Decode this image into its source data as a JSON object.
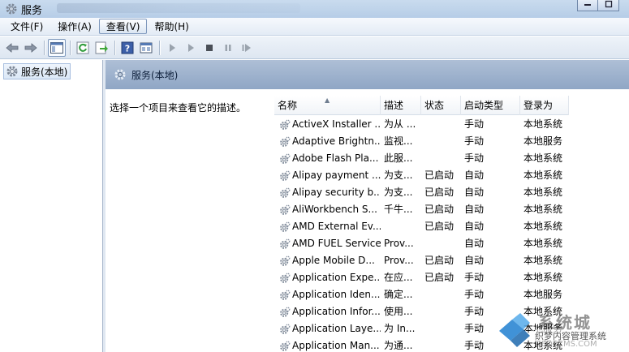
{
  "window": {
    "title": "服务",
    "controls": [
      "minimize",
      "maximize"
    ]
  },
  "menu": [
    {
      "label": "文件(F)"
    },
    {
      "label": "操作(A)"
    },
    {
      "label": "查看(V)"
    },
    {
      "label": "帮助(H)"
    }
  ],
  "tree": {
    "root_label": "服务(本地)"
  },
  "content": {
    "header_title": "服务(本地)",
    "description": "选择一个项目来查看它的描述。"
  },
  "columns": [
    "名称",
    "描述",
    "状态",
    "启动类型",
    "登录为"
  ],
  "services": [
    {
      "name": "ActiveX Installer ...",
      "desc": "为从 ...",
      "status": "",
      "startup": "手动",
      "logon": "本地系统"
    },
    {
      "name": "Adaptive Brightn...",
      "desc": "监视...",
      "status": "",
      "startup": "手动",
      "logon": "本地服务"
    },
    {
      "name": "Adobe Flash Pla...",
      "desc": "此服...",
      "status": "",
      "startup": "手动",
      "logon": "本地系统"
    },
    {
      "name": "Alipay payment ...",
      "desc": "为支...",
      "status": "已启动",
      "startup": "自动",
      "logon": "本地系统"
    },
    {
      "name": "Alipay security b...",
      "desc": "为支...",
      "status": "已启动",
      "startup": "自动",
      "logon": "本地系统"
    },
    {
      "name": "AliWorkbench S...",
      "desc": "千牛...",
      "status": "已启动",
      "startup": "自动",
      "logon": "本地系统"
    },
    {
      "name": "AMD External Ev...",
      "desc": "",
      "status": "已启动",
      "startup": "自动",
      "logon": "本地系统"
    },
    {
      "name": "AMD FUEL Service",
      "desc": "Prov...",
      "status": "",
      "startup": "自动",
      "logon": "本地系统"
    },
    {
      "name": "Apple Mobile D...",
      "desc": "Prov...",
      "status": "已启动",
      "startup": "自动",
      "logon": "本地系统"
    },
    {
      "name": "Application Expe...",
      "desc": "在应...",
      "status": "已启动",
      "startup": "手动",
      "logon": "本地系统"
    },
    {
      "name": "Application Iden...",
      "desc": "确定...",
      "status": "",
      "startup": "手动",
      "logon": "本地服务"
    },
    {
      "name": "Application Infor...",
      "desc": "使用...",
      "status": "",
      "startup": "手动",
      "logon": "本地系统"
    },
    {
      "name": "Application Laye...",
      "desc": "为 In...",
      "status": "",
      "startup": "手动",
      "logon": "本地服务"
    },
    {
      "name": "Application Man...",
      "desc": "为通...",
      "status": "",
      "startup": "手动",
      "logon": "本地系统"
    }
  ],
  "watermark": {
    "text_main": "系统城",
    "text_sub": "织梦内容管理系统",
    "text_url": "DEDECMS.COM"
  },
  "colors": {
    "title_bar": "#b6cde7",
    "menu_bar": "#e3ebf5",
    "content_header": "#8fa6c5",
    "selection_border": "#7f99bd"
  },
  "icons": [
    "services-gear-icon",
    "back-arrow-icon",
    "forward-arrow-icon",
    "console-tree-icon",
    "refresh-icon",
    "export-list-icon",
    "help-icon",
    "properties-icon",
    "play-icon",
    "play-icon",
    "stop-icon",
    "pause-icon",
    "restart-icon"
  ]
}
